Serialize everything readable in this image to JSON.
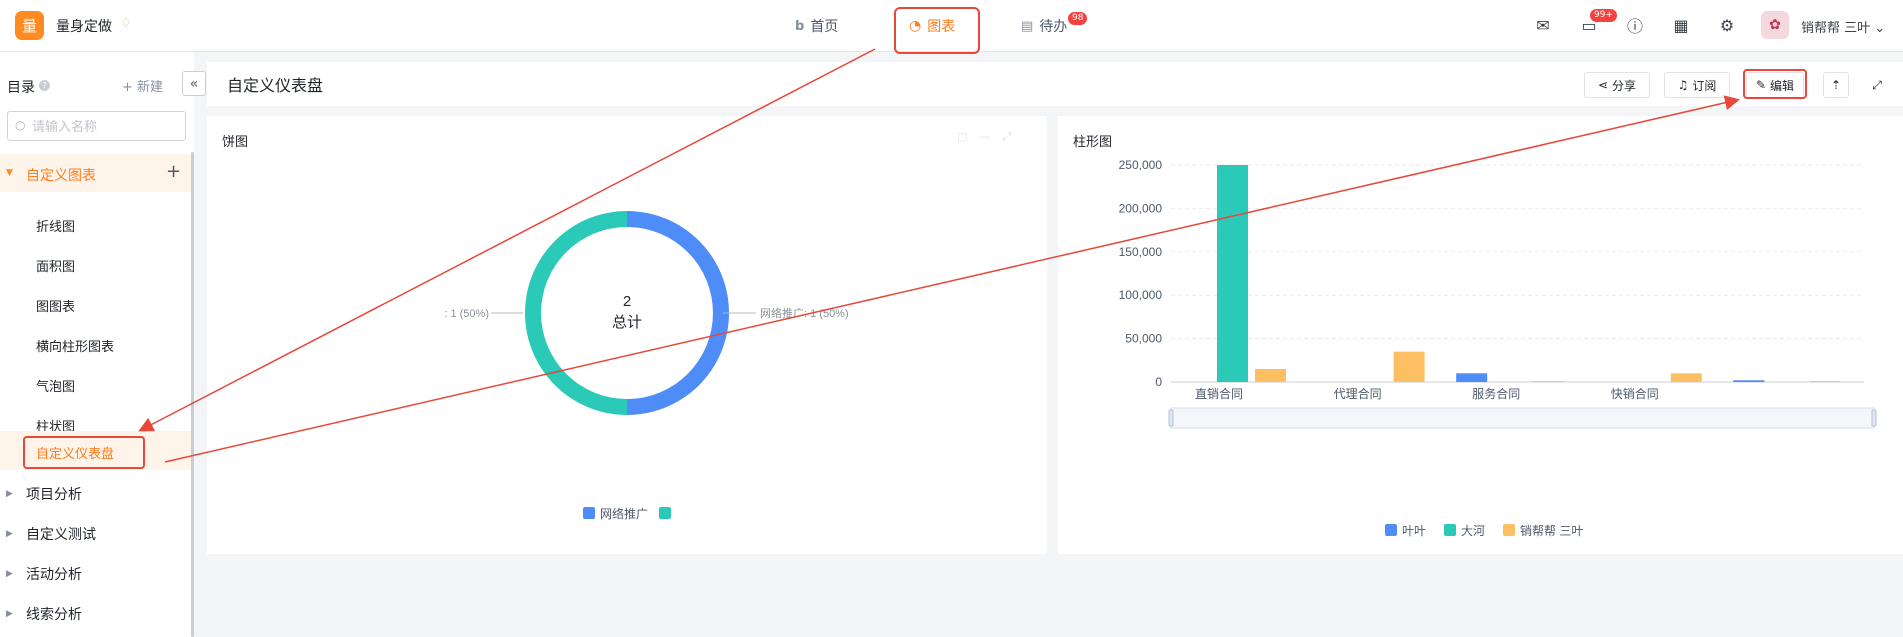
{
  "app": {
    "logo_char": "量",
    "brand": "量身定做"
  },
  "nav": [
    {
      "label": "首页",
      "icon": "b"
    },
    {
      "label": "图表",
      "icon": "◔"
    },
    {
      "label": "待办",
      "icon": "▤",
      "badge": "98"
    }
  ],
  "topbar": {
    "chat_badge": "99+",
    "username": "销帮帮 三叶",
    "caret": "⌄"
  },
  "sidebar": {
    "title": "目录",
    "new_label": "新建",
    "search_placeholder": "请输入名称",
    "group": "自定义图表",
    "items": [
      "折线图",
      "面积图",
      "图图表",
      "横向柱形图表",
      "气泡图",
      "柱状图"
    ],
    "active_item": "自定义仪表盘",
    "folders": [
      "项目分析",
      "自定义测试",
      "活动分析",
      "线索分析"
    ]
  },
  "header": {
    "title": "自定义仪表盘",
    "share": "分享",
    "subscribe": "订阅",
    "edit": "编辑"
  },
  "pie_card": {
    "title": "饼图",
    "total_value": "2",
    "total_label": "总计",
    "left_label": ": 1 (50%)",
    "right_label": "网络推广: 1 (50%)",
    "legend": [
      {
        "name": "网络推广",
        "color": "#4e8cf7"
      },
      {
        "name": "",
        "color": "#2bcab8"
      }
    ]
  },
  "bar_card": {
    "title": "柱形图"
  },
  "chart_data": [
    {
      "type": "pie",
      "title": "饼图",
      "categories": [
        "网络推广",
        ""
      ],
      "values": [
        1,
        1
      ],
      "colors": [
        "#4e8cf7",
        "#2bcab8"
      ]
    },
    {
      "type": "bar",
      "title": "柱形图",
      "categories": [
        "直销合同",
        "代理合同",
        "服务合同",
        "快销合同",
        ""
      ],
      "ylim": [
        0,
        250000
      ],
      "yticks": [
        "250,000",
        "200,000",
        "150,000",
        "100,000",
        "50,000",
        "0"
      ],
      "series": [
        {
          "name": "叶叶",
          "color": "#4e8cf7",
          "values": [
            0,
            0,
            10000,
            0,
            2000
          ]
        },
        {
          "name": "大河",
          "color": "#2bcab8",
          "values": [
            250000,
            0,
            0,
            0,
            0
          ]
        },
        {
          "name": "销帮帮 三叶",
          "color": "#fcc062",
          "values": [
            15000,
            35000,
            1000,
            10000,
            1000
          ]
        }
      ],
      "grid": true,
      "legend": "bottom"
    }
  ]
}
